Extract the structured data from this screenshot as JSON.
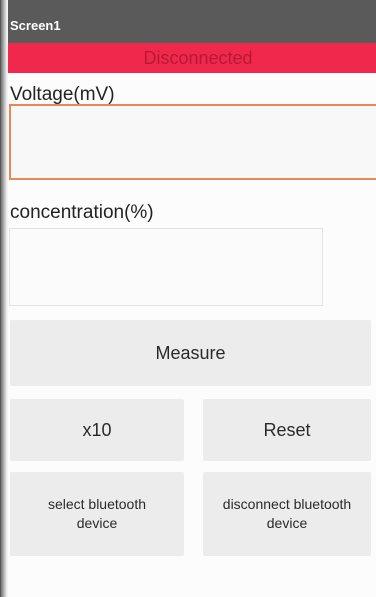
{
  "app": {
    "screen_title": "Screen1",
    "status_text": "Disconnected",
    "status_color": "#f0284c"
  },
  "fields": {
    "voltage_label": "Voltage(mV)",
    "voltage_value": "",
    "concentration_label": "concentration(%)",
    "concentration_value": ""
  },
  "buttons": {
    "measure_label": "Measure",
    "x10_label": "x10",
    "reset_label": "Reset",
    "select_bluetooth_label": "select bluetooth device",
    "disconnect_bluetooth_label": "disconnect bluetooth device"
  },
  "colors": {
    "titlebar": "#5a5a5a",
    "input_focus_border": "#e58a56",
    "button_bg": "#ececec"
  }
}
